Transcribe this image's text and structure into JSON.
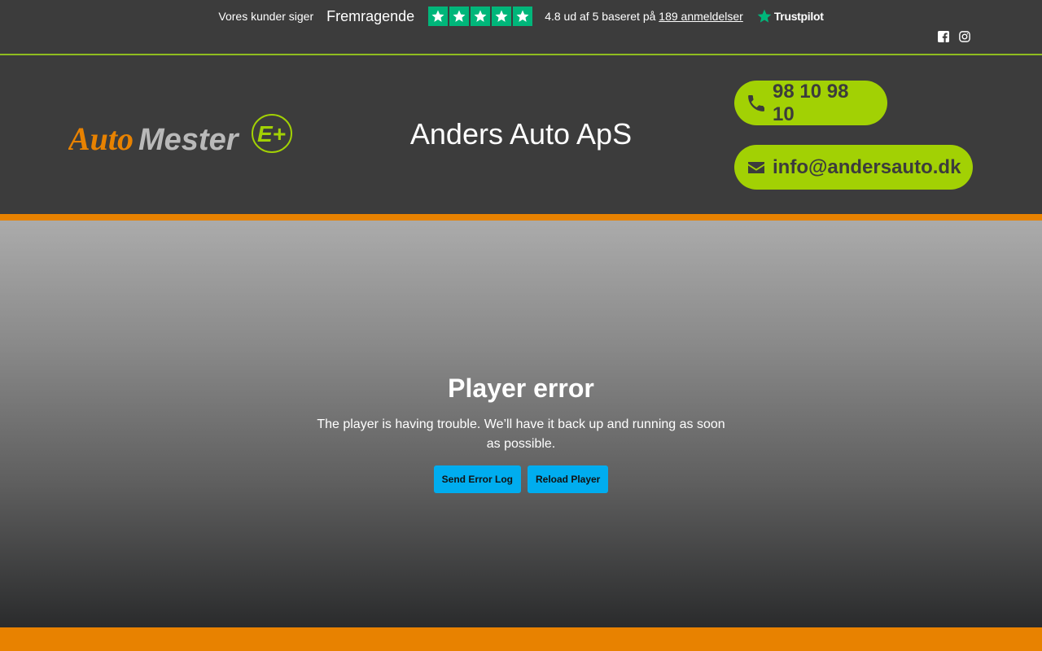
{
  "trustpilot": {
    "say": "Vores kunder siger",
    "rating_word": "Fremragende",
    "stars": 5,
    "summary_prefix": "4.8 ud af 5 baseret på",
    "reviews_link": "189 anmeldelser",
    "brand": "Trustpilot",
    "star_color": "#00b67a"
  },
  "social": {
    "icons": [
      "facebook-icon",
      "instagram-icon"
    ]
  },
  "header": {
    "logo": {
      "text_auto": "Auto",
      "text_mester": "Mester",
      "text_badge": "E+"
    },
    "company": "Anders Auto ApS",
    "phone": "98 10 98 10",
    "email": "info@andersauto.dk",
    "accent": "#a2d104",
    "brand_orange": "#e88200"
  },
  "player": {
    "title": "Player error",
    "message": "The player is having trouble. We’ll have it back up and running as soon as possible.",
    "btn_send": "Send Error Log",
    "btn_reload": "Reload Player",
    "btn_color": "#00adef"
  }
}
